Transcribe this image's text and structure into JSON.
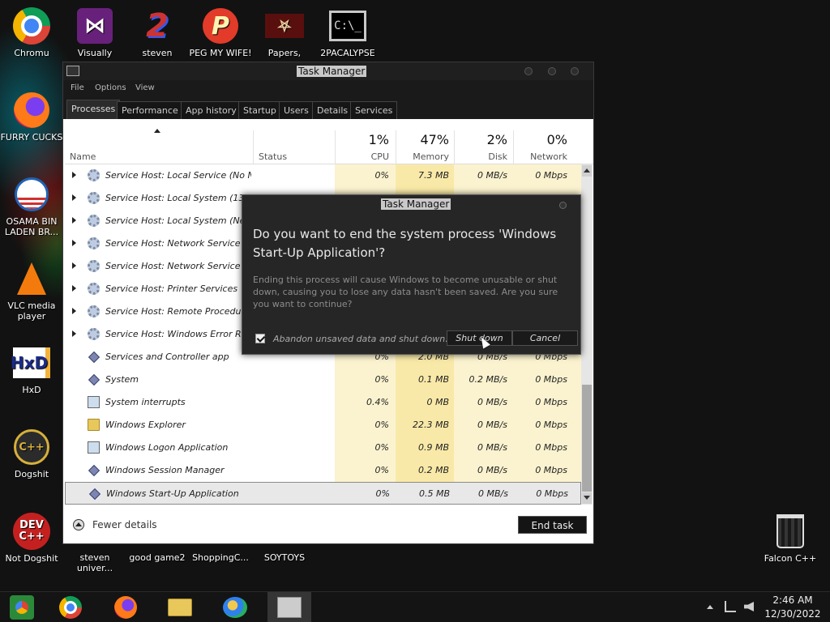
{
  "desktop": {
    "icons": [
      {
        "label": "Chromu",
        "icon": "chrome-icon"
      },
      {
        "label": "Visually",
        "icon": "visual-studio-icon"
      },
      {
        "label": "steven",
        "icon": "steven-icon"
      },
      {
        "label": "PEG MY WIFE!",
        "icon": "peg-icon"
      },
      {
        "label": "Papers,",
        "icon": "papers-please-icon"
      },
      {
        "label": "2PACALYPSE",
        "icon": "command-prompt-icon"
      },
      {
        "label": "FURRY CUCKS",
        "icon": "firefox-icon"
      },
      {
        "label": "OSAMA BIN LADEN BR...",
        "icon": "obama-icon"
      },
      {
        "label": "VLC media player",
        "icon": "vlc-icon"
      },
      {
        "label": "HxD",
        "icon": "hxd-icon"
      },
      {
        "label": "Dogshit",
        "icon": "dogshit-icon",
        "glyph": "C++"
      },
      {
        "label": "Not Dogshit",
        "icon": "devcpp-icon",
        "glyph": "DEV C++"
      },
      {
        "label": "steven univer...",
        "icon": "steven-universe-icon"
      },
      {
        "label": "good game2",
        "icon": "good-game-icon"
      },
      {
        "label": "ShoppingC...",
        "icon": "shopping-icon"
      },
      {
        "label": "SOYTOYS",
        "icon": "soytoys-icon"
      },
      {
        "label": "Falcon C++",
        "icon": "recycle-bin-icon"
      }
    ]
  },
  "task_manager": {
    "title": "Task Manager",
    "menu": [
      "File",
      "Options",
      "View"
    ],
    "tabs": [
      "Processes",
      "Performance",
      "App history",
      "Startup",
      "Users",
      "Details",
      "Services"
    ],
    "active_tab": "Processes",
    "columns": {
      "name": "Name",
      "status": "Status",
      "cpu_pct": "1%",
      "cpu": "CPU",
      "memory_pct": "47%",
      "memory": "Memory",
      "disk_pct": "2%",
      "disk": "Disk",
      "network_pct": "0%",
      "network": "Network"
    },
    "rows": [
      {
        "name": "Service Host: Local Service (No N...",
        "icon": "gear-icon",
        "expandable": true,
        "cpu": "0%",
        "memory": "7.3 MB",
        "disk": "0 MB/s",
        "network": "0 Mbps"
      },
      {
        "name": "Service Host: Local System (13)",
        "icon": "gear-icon",
        "expandable": true,
        "cpu": "",
        "memory": "",
        "disk": "",
        "network": ""
      },
      {
        "name": "Service Host: Local System (Netw...",
        "icon": "gear-icon",
        "expandable": true,
        "cpu": "",
        "memory": "",
        "disk": "",
        "network": ""
      },
      {
        "name": "Service Host: Network Service (5)",
        "icon": "gear-icon",
        "expandable": true,
        "cpu": "",
        "memory": "",
        "disk": "",
        "network": ""
      },
      {
        "name": "Service Host: Network Service (N...",
        "icon": "gear-icon",
        "expandable": true,
        "cpu": "",
        "memory": "",
        "disk": "",
        "network": ""
      },
      {
        "name": "Service Host: Printer Services",
        "icon": "gear-icon",
        "expandable": true,
        "cpu": "",
        "memory": "",
        "disk": "",
        "network": ""
      },
      {
        "name": "Service Host: Remote Procedure C...",
        "icon": "gear-icon",
        "expandable": true,
        "cpu": "",
        "memory": "",
        "disk": "",
        "network": ""
      },
      {
        "name": "Service Host: Windows Error Repo...",
        "icon": "gear-icon",
        "expandable": true,
        "cpu": "",
        "memory": "",
        "disk": "",
        "network": ""
      },
      {
        "name": "Services and Controller app",
        "icon": "diamond-icon",
        "expandable": false,
        "cpu": "0%",
        "memory": "2.0 MB",
        "disk": "0 MB/s",
        "network": "0 Mbps"
      },
      {
        "name": "System",
        "icon": "diamond-icon",
        "expandable": false,
        "cpu": "0%",
        "memory": "0.1 MB",
        "disk": "0.2 MB/s",
        "network": "0 Mbps"
      },
      {
        "name": "System interrupts",
        "icon": "window-icon",
        "expandable": false,
        "cpu": "0.4%",
        "memory": "0 MB",
        "disk": "0 MB/s",
        "network": "0 Mbps"
      },
      {
        "name": "Windows Explorer",
        "icon": "folder-icon",
        "expandable": false,
        "cpu": "0%",
        "memory": "22.3 MB",
        "disk": "0 MB/s",
        "network": "0 Mbps"
      },
      {
        "name": "Windows Logon Application",
        "icon": "window-icon",
        "expandable": false,
        "cpu": "0%",
        "memory": "0.9 MB",
        "disk": "0 MB/s",
        "network": "0 Mbps"
      },
      {
        "name": "Windows Session Manager",
        "icon": "diamond-icon",
        "expandable": false,
        "cpu": "0%",
        "memory": "0.2 MB",
        "disk": "0 MB/s",
        "network": "0 Mbps"
      },
      {
        "name": "Windows Start-Up Application",
        "icon": "diamond-icon",
        "expandable": false,
        "cpu": "0%",
        "memory": "0.5 MB",
        "disk": "0 MB/s",
        "network": "0 Mbps",
        "selected": true
      }
    ],
    "fewer_details": "Fewer details",
    "end_task": "End task"
  },
  "dialog": {
    "title": "Task Manager",
    "question": "Do you want to end the system process 'Windows Start-Up Application'?",
    "message": "Ending this process will cause Windows to become unusable or shut down, causing you to lose any data hasn't been saved. Are you sure you want to continue?",
    "checkbox_label": "Abandon unsaved data and shut down.",
    "checkbox_checked": true,
    "shutdown_label": "Shut down",
    "cancel_label": "Cancel"
  },
  "taskbar": {
    "apps": [
      "start-icon",
      "chrome-icon",
      "firefox-icon",
      "file-explorer-icon",
      "people-icon",
      "task-manager-icon"
    ],
    "active_app": "task-manager-icon",
    "time": "2:46 AM",
    "date": "12/30/2022"
  },
  "colors": {
    "cpu_heat": "#fbf3cf",
    "memory_heat": "#f9e9a8",
    "disk_heat": "#fbf3cf",
    "network_heat": "#fbf3cf"
  }
}
